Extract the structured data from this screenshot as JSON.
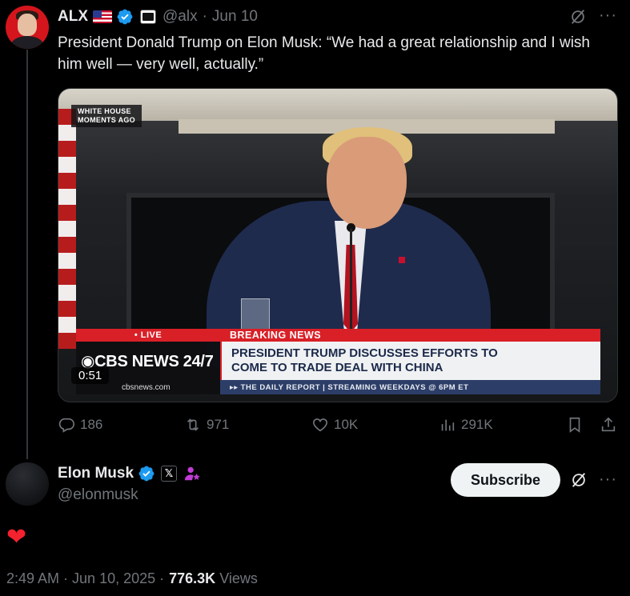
{
  "tweet": {
    "author": {
      "name": "ALX",
      "handle": "@alx",
      "icons": [
        "us-flag-icon",
        "verified-badge-icon",
        "affiliate-badge-icon"
      ]
    },
    "date_sep": "·",
    "date": "Jun 10",
    "text": "President Donald Trump on Elon Musk: “We had a great relationship and I wish him well — very well, actually.”",
    "media": {
      "type": "video",
      "duration": "0:51",
      "overlay": {
        "corner_bug_line1": "WHITE HOUSE",
        "corner_bug_line2": "MOMENTS AGO",
        "live_label": "• LIVE",
        "breaking_label": "BREAKING NEWS",
        "network": "◉CBS NEWS 24/7",
        "headline_line1": "PRESIDENT TRUMP DISCUSSES EFFORTS TO",
        "headline_line2": "COME TO TRADE DEAL WITH CHINA",
        "url": "cbsnews.com",
        "ticker": "▸▸ THE DAILY REPORT | STREAMING WEEKDAYS @ 6PM ET"
      }
    },
    "actions": {
      "replies": "186",
      "reposts": "971",
      "likes": "10K",
      "views": "291K"
    }
  },
  "reply": {
    "author": {
      "name": "Elon Musk",
      "handle": "@elonmusk",
      "icons": [
        "verified-badge-icon",
        "x-affiliate-icon",
        "person-star-icon"
      ]
    },
    "subscribe_label": "Subscribe",
    "content_emoji": "❤",
    "time": "2:49 AM",
    "sep": "·",
    "date": "Jun 10, 2025",
    "views_count": "776.3K",
    "views_label": "Views"
  },
  "colors": {
    "background": "#000000",
    "text_primary": "#e7e9ea",
    "text_secondary": "#71767b",
    "verified_blue": "#1d9bf0",
    "heart_red": "#f4212e",
    "cbs_red": "#d92027"
  }
}
